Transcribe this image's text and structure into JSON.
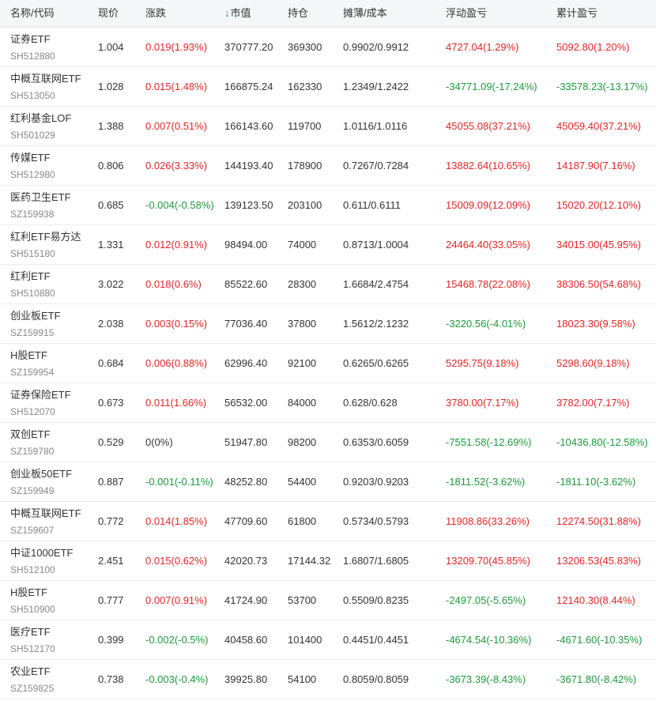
{
  "header": {
    "name_code": "名称/代码",
    "price": "现价",
    "change": "涨跌",
    "market_value": "市值",
    "sort_icon": "arrow-down",
    "position": "持仓",
    "cost": "摊薄/成本",
    "floating_pl": "浮动盈亏",
    "cumulative_pl": "累计盈亏"
  },
  "colors": {
    "up": "#e02626",
    "down": "#1c9a3a",
    "accent": "#1a7fe0"
  },
  "rows": [
    {
      "name": "证券ETF",
      "code": "SH512880",
      "price": "1.004",
      "change": "0.019(1.93%)",
      "change_dir": "up",
      "market_value": "370777.20",
      "position": "369300",
      "cost": "0.9902/0.9912",
      "floating_pl": "4727.04(1.29%)",
      "floating_dir": "up",
      "cumulative_pl": "5092.80(1.20%)",
      "cumulative_dir": "up"
    },
    {
      "name": "中概互联网ETF",
      "code": "SH513050",
      "price": "1.028",
      "change": "0.015(1.48%)",
      "change_dir": "up",
      "market_value": "166875.24",
      "position": "162330",
      "cost": "1.2349/1.2422",
      "floating_pl": "-34771.09(-17.24%)",
      "floating_dir": "down",
      "cumulative_pl": "-33578.23(-13.17%)",
      "cumulative_dir": "down"
    },
    {
      "name": "红利基金LOF",
      "code": "SH501029",
      "price": "1.388",
      "change": "0.007(0.51%)",
      "change_dir": "up",
      "market_value": "166143.60",
      "position": "119700",
      "cost": "1.0116/1.0116",
      "floating_pl": "45055.08(37.21%)",
      "floating_dir": "up",
      "cumulative_pl": "45059.40(37.21%)",
      "cumulative_dir": "up"
    },
    {
      "name": "传媒ETF",
      "code": "SH512980",
      "price": "0.806",
      "change": "0.026(3.33%)",
      "change_dir": "up",
      "market_value": "144193.40",
      "position": "178900",
      "cost": "0.7267/0.7284",
      "floating_pl": "13882.64(10.65%)",
      "floating_dir": "up",
      "cumulative_pl": "14187.90(7.16%)",
      "cumulative_dir": "up"
    },
    {
      "name": "医药卫生ETF",
      "code": "SZ159938",
      "price": "0.685",
      "change": "-0.004(-0.58%)",
      "change_dir": "down",
      "market_value": "139123.50",
      "position": "203100",
      "cost": "0.611/0.6111",
      "floating_pl": "15009.09(12.09%)",
      "floating_dir": "up",
      "cumulative_pl": "15020.20(12.10%)",
      "cumulative_dir": "up"
    },
    {
      "name": "红利ETF易方达",
      "code": "SH515180",
      "price": "1.331",
      "change": "0.012(0.91%)",
      "change_dir": "up",
      "market_value": "98494.00",
      "position": "74000",
      "cost": "0.8713/1.0004",
      "floating_pl": "24464.40(33.05%)",
      "floating_dir": "up",
      "cumulative_pl": "34015.00(45.95%)",
      "cumulative_dir": "up"
    },
    {
      "name": "红利ETF",
      "code": "SH510880",
      "price": "3.022",
      "change": "0.018(0.6%)",
      "change_dir": "up",
      "market_value": "85522.60",
      "position": "28300",
      "cost": "1.6684/2.4754",
      "floating_pl": "15468.78(22.08%)",
      "floating_dir": "up",
      "cumulative_pl": "38306.50(54.68%)",
      "cumulative_dir": "up"
    },
    {
      "name": "创业板ETF",
      "code": "SZ159915",
      "price": "2.038",
      "change": "0.003(0.15%)",
      "change_dir": "up",
      "market_value": "77036.40",
      "position": "37800",
      "cost": "1.5612/2.1232",
      "floating_pl": "-3220.56(-4.01%)",
      "floating_dir": "down",
      "cumulative_pl": "18023.30(9.58%)",
      "cumulative_dir": "up"
    },
    {
      "name": "H股ETF",
      "code": "SZ159954",
      "price": "0.684",
      "change": "0.006(0.88%)",
      "change_dir": "up",
      "market_value": "62996.40",
      "position": "92100",
      "cost": "0.6265/0.6265",
      "floating_pl": "5295.75(9.18%)",
      "floating_dir": "up",
      "cumulative_pl": "5298.60(9.18%)",
      "cumulative_dir": "up"
    },
    {
      "name": "证券保险ETF",
      "code": "SH512070",
      "price": "0.673",
      "change": "0.011(1.66%)",
      "change_dir": "up",
      "market_value": "56532.00",
      "position": "84000",
      "cost": "0.628/0.628",
      "floating_pl": "3780.00(7.17%)",
      "floating_dir": "up",
      "cumulative_pl": "3782.00(7.17%)",
      "cumulative_dir": "up"
    },
    {
      "name": "双创ETF",
      "code": "SZ159780",
      "price": "0.529",
      "change": "0(0%)",
      "change_dir": "flat",
      "market_value": "51947.80",
      "position": "98200",
      "cost": "0.6353/0.6059",
      "floating_pl": "-7551.58(-12.69%)",
      "floating_dir": "down",
      "cumulative_pl": "-10436.80(-12.58%)",
      "cumulative_dir": "down"
    },
    {
      "name": "创业板50ETF",
      "code": "SZ159949",
      "price": "0.887",
      "change": "-0.001(-0.11%)",
      "change_dir": "down",
      "market_value": "48252.80",
      "position": "54400",
      "cost": "0.9203/0.9203",
      "floating_pl": "-1811.52(-3.62%)",
      "floating_dir": "down",
      "cumulative_pl": "-1811.10(-3.62%)",
      "cumulative_dir": "down"
    },
    {
      "name": "中概互联网ETF",
      "code": "SZ159607",
      "price": "0.772",
      "change": "0.014(1.85%)",
      "change_dir": "up",
      "market_value": "47709.60",
      "position": "61800",
      "cost": "0.5734/0.5793",
      "floating_pl": "11908.86(33.26%)",
      "floating_dir": "up",
      "cumulative_pl": "12274.50(31.88%)",
      "cumulative_dir": "up"
    },
    {
      "name": "中证1000ETF",
      "code": "SH512100",
      "price": "2.451",
      "change": "0.015(0.62%)",
      "change_dir": "up",
      "market_value": "42020.73",
      "position": "17144.32",
      "cost": "1.6807/1.6805",
      "floating_pl": "13209.70(45.85%)",
      "floating_dir": "up",
      "cumulative_pl": "13206.53(45.83%)",
      "cumulative_dir": "up"
    },
    {
      "name": "H股ETF",
      "code": "SH510900",
      "price": "0.777",
      "change": "0.007(0.91%)",
      "change_dir": "up",
      "market_value": "41724.90",
      "position": "53700",
      "cost": "0.5509/0.8235",
      "floating_pl": "-2497.05(-5.65%)",
      "floating_dir": "down",
      "cumulative_pl": "12140.30(8.44%)",
      "cumulative_dir": "up"
    },
    {
      "name": "医疗ETF",
      "code": "SH512170",
      "price": "0.399",
      "change": "-0.002(-0.5%)",
      "change_dir": "down",
      "market_value": "40458.60",
      "position": "101400",
      "cost": "0.4451/0.4451",
      "floating_pl": "-4674.54(-10.36%)",
      "floating_dir": "down",
      "cumulative_pl": "-4671.60(-10.35%)",
      "cumulative_dir": "down"
    },
    {
      "name": "农业ETF",
      "code": "SZ159825",
      "price": "0.738",
      "change": "-0.003(-0.4%)",
      "change_dir": "down",
      "market_value": "39925.80",
      "position": "54100",
      "cost": "0.8059/0.8059",
      "floating_pl": "-3673.39(-8.43%)",
      "floating_dir": "down",
      "cumulative_pl": "-3671.80(-8.42%)",
      "cumulative_dir": "down"
    }
  ]
}
